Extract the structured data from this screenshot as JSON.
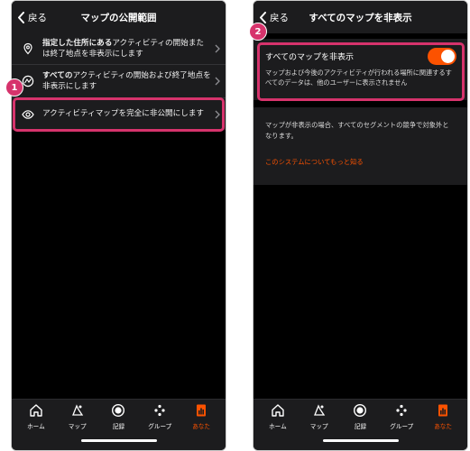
{
  "left_screen": {
    "back_label": "戻る",
    "title": "マップの公開範囲",
    "rows": [
      {
        "icon": "location-pin-icon",
        "bold_text": "指定した住所にある",
        "text": "アクティビティの開始または終了地点を非表示にします"
      },
      {
        "icon": "activity-map-icon",
        "bold_text": "すべての",
        "text": "アクティビティの開始および終了地点を非表示にします"
      },
      {
        "icon": "eye-icon",
        "bold_text": "",
        "text": "アクティビティマップを完全に非公開にします"
      }
    ],
    "step_badge": "1"
  },
  "right_screen": {
    "back_label": "戻る",
    "title": "すべてのマップを非表示",
    "toggle_label": "すべてのマップを非表示",
    "toggle_state": "on",
    "toggle_description": "マップおよび今後のアクティビティが行われる場所に関連するすべてのデータは、他のユーザーに表示されません",
    "info_text": "マップが非表示の場合、すべてのセグメントの競争で対象外となります。",
    "link_text": "このシステムについてもっと知る",
    "step_badge": "2"
  },
  "tabbar": {
    "items": [
      {
        "label": "ホーム",
        "icon": "home-icon",
        "active": false
      },
      {
        "label": "マップ",
        "icon": "map-icon",
        "active": false
      },
      {
        "label": "記録",
        "icon": "record-icon",
        "active": false
      },
      {
        "label": "グループ",
        "icon": "group-icon",
        "active": false
      },
      {
        "label": "あなた",
        "icon": "profile-icon",
        "active": true
      }
    ]
  },
  "colors": {
    "accent": "#fc5200",
    "highlight": "#d6336c",
    "panel": "#1c1c1e",
    "background": "#000000"
  }
}
